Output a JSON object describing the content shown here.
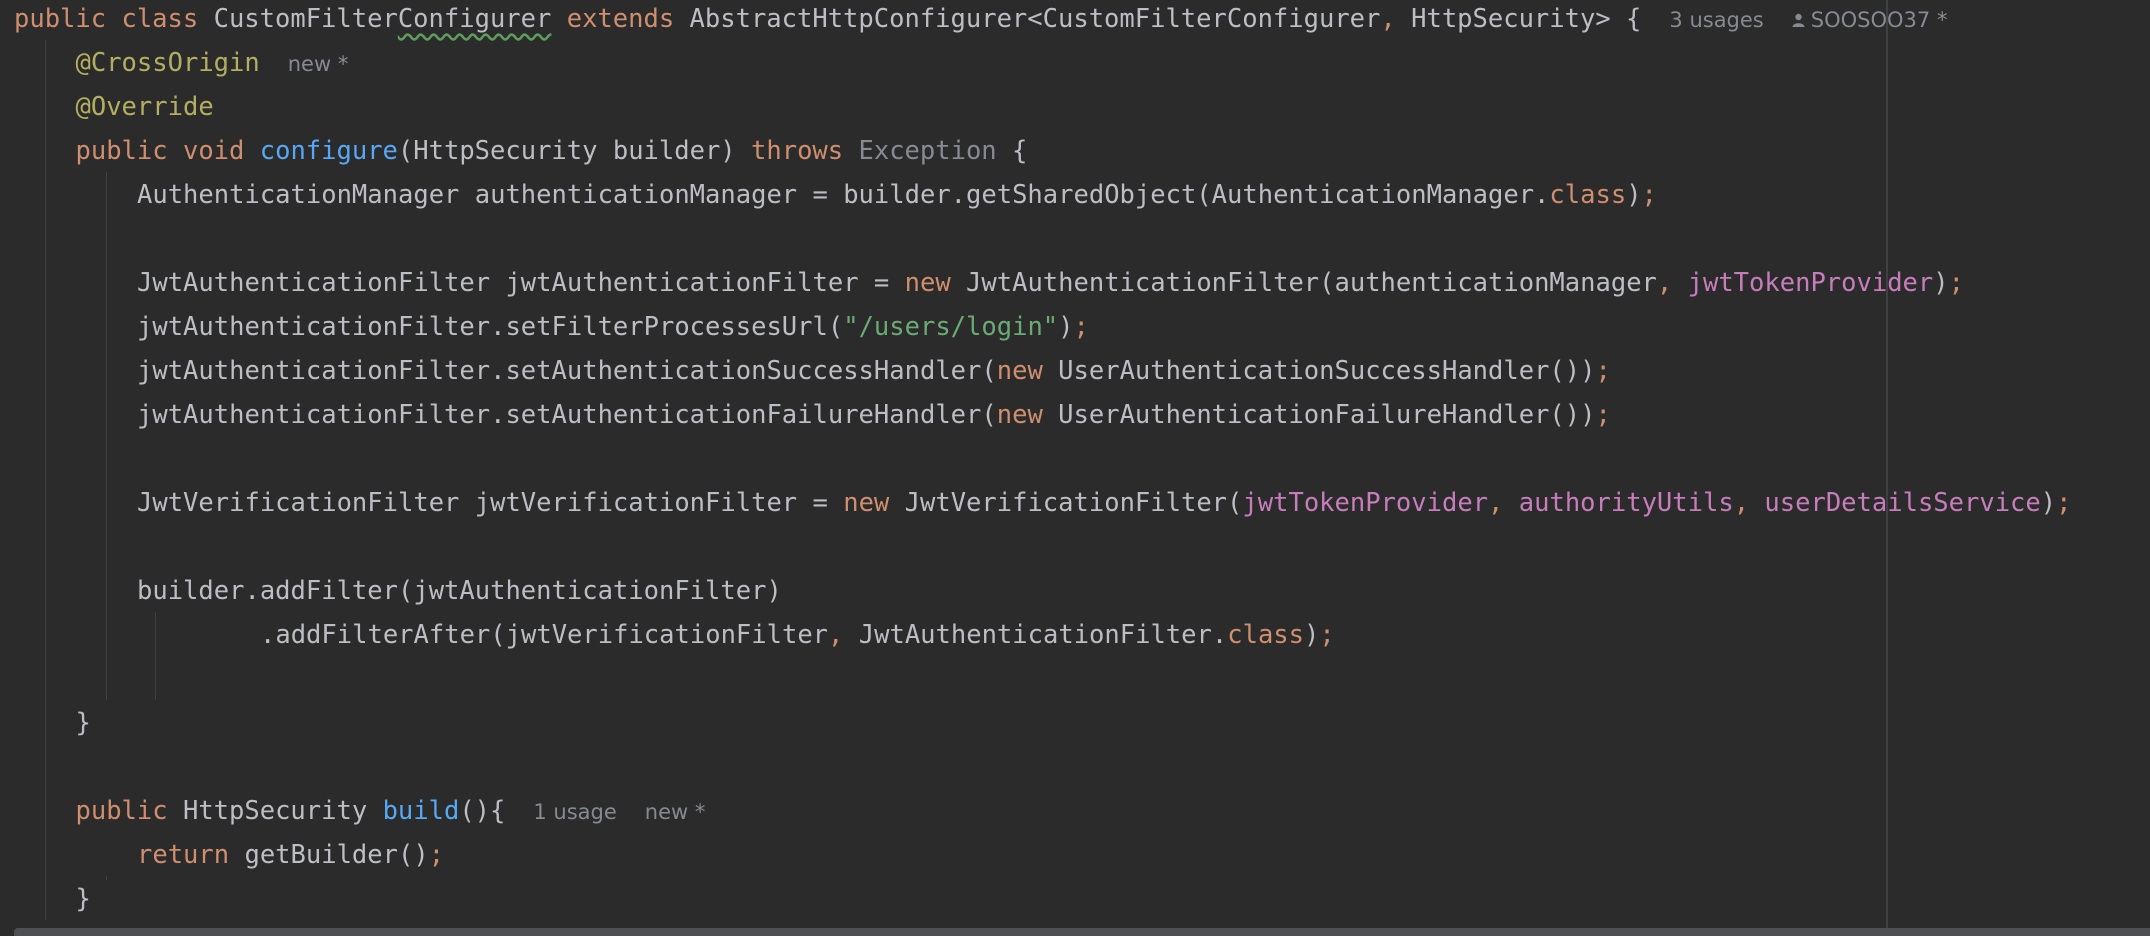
{
  "editor": {
    "lines": [
      {
        "indent": 0,
        "tokens": [
          [
            "kw",
            "public class "
          ],
          [
            "plain",
            "CustomFilter"
          ],
          [
            "plain squiggle",
            "Configurer"
          ],
          [
            "kw",
            " extends "
          ],
          [
            "plain",
            "AbstractHttpConfigurer<CustomFilterConfigurer"
          ],
          [
            "kw",
            ", "
          ],
          [
            "plain",
            "HttpSecurity> {"
          ]
        ],
        "hints": [
          "3 usages",
          "SOOSOO37 *"
        ]
      },
      {
        "indent": 1,
        "tokens": [
          [
            "ann",
            "@CrossOrigin"
          ]
        ],
        "hints": [
          "new *"
        ]
      },
      {
        "indent": 1,
        "tokens": [
          [
            "ann",
            "@Override"
          ]
        ],
        "hints": []
      },
      {
        "indent": 1,
        "tokens": [
          [
            "kw",
            "public void "
          ],
          [
            "fn",
            "configure"
          ],
          [
            "plain",
            "(HttpSecurity builder) "
          ],
          [
            "kw",
            "throws "
          ],
          [
            "gray",
            "Exception"
          ],
          [
            "plain",
            " {"
          ]
        ],
        "hints": []
      },
      {
        "indent": 2,
        "tokens": [
          [
            "plain",
            "AuthenticationManager authenticationManager = builder.getSharedObject(AuthenticationManager."
          ],
          [
            "kw",
            "class"
          ],
          [
            "plain",
            ")"
          ],
          [
            "kw",
            ";"
          ]
        ],
        "hints": []
      },
      {
        "indent": 0,
        "tokens": [],
        "hints": []
      },
      {
        "indent": 2,
        "tokens": [
          [
            "plain",
            "JwtAuthenticationFilter jwtAuthenticationFilter = "
          ],
          [
            "kw",
            "new "
          ],
          [
            "plain",
            "JwtAuthenticationFilter(authenticationManager"
          ],
          [
            "kw",
            ", "
          ],
          [
            "field",
            "jwtTokenProvider"
          ],
          [
            "plain",
            ")"
          ],
          [
            "kw",
            ";"
          ]
        ],
        "hints": []
      },
      {
        "indent": 2,
        "tokens": [
          [
            "plain",
            "jwtAuthenticationFilter.setFilterProcessesUrl("
          ],
          [
            "str",
            "\"/users/login\""
          ],
          [
            "plain",
            ")"
          ],
          [
            "kw",
            ";"
          ]
        ],
        "hints": []
      },
      {
        "indent": 2,
        "tokens": [
          [
            "plain",
            "jwtAuthenticationFilter.setAuthenticationSuccessHandler("
          ],
          [
            "kw",
            "new "
          ],
          [
            "plain",
            "UserAuthenticationSuccessHandler())"
          ],
          [
            "kw",
            ";"
          ]
        ],
        "hints": []
      },
      {
        "indent": 2,
        "tokens": [
          [
            "plain",
            "jwtAuthenticationFilter.setAuthenticationFailureHandler("
          ],
          [
            "kw",
            "new "
          ],
          [
            "plain",
            "UserAuthenticationFailureHandler())"
          ],
          [
            "kw",
            ";"
          ]
        ],
        "hints": []
      },
      {
        "indent": 0,
        "tokens": [],
        "hints": []
      },
      {
        "indent": 2,
        "tokens": [
          [
            "plain",
            "JwtVerificationFilter jwtVerificationFilter = "
          ],
          [
            "kw",
            "new "
          ],
          [
            "plain",
            "JwtVerificationFilter("
          ],
          [
            "field",
            "jwtTokenProvider"
          ],
          [
            "kw",
            ", "
          ],
          [
            "field",
            "authorityUtils"
          ],
          [
            "kw",
            ", "
          ],
          [
            "field",
            "userDetailsService"
          ],
          [
            "plain",
            ")"
          ],
          [
            "kw",
            ";"
          ]
        ],
        "hints": []
      },
      {
        "indent": 0,
        "tokens": [],
        "hints": []
      },
      {
        "indent": 2,
        "tokens": [
          [
            "plain",
            "builder.addFilter(jwtAuthenticationFilter)"
          ]
        ],
        "hints": []
      },
      {
        "indent": 4,
        "tokens": [
          [
            "plain",
            ".addFilterAfter(jwtVerificationFilter"
          ],
          [
            "kw",
            ", "
          ],
          [
            "plain",
            "JwtAuthenticationFilter."
          ],
          [
            "kw",
            "class"
          ],
          [
            "plain",
            ")"
          ],
          [
            "kw",
            ";"
          ]
        ],
        "hints": []
      },
      {
        "indent": 0,
        "tokens": [],
        "hints": []
      },
      {
        "indent": 1,
        "tokens": [
          [
            "plain",
            "}"
          ]
        ],
        "hints": []
      },
      {
        "indent": 0,
        "tokens": [],
        "hints": []
      },
      {
        "indent": 1,
        "tokens": [
          [
            "kw",
            "public "
          ],
          [
            "plain",
            "HttpSecurity "
          ],
          [
            "fn",
            "build"
          ],
          [
            "plain",
            "(){"
          ]
        ],
        "hints": [
          "1 usage",
          "new *"
        ]
      },
      {
        "indent": 2,
        "tokens": [
          [
            "kw",
            "return "
          ],
          [
            "plain",
            "getBuilder()"
          ],
          [
            "kw",
            ";"
          ]
        ],
        "hints": []
      },
      {
        "indent": 1,
        "tokens": [
          [
            "plain",
            "}"
          ]
        ],
        "hints": []
      }
    ]
  },
  "colors": {
    "background": "#2b2b2c",
    "keyword": "#cf8e6d",
    "method": "#56a8f5",
    "annotation": "#b3ae60",
    "string": "#6aab73",
    "field": "#c77dbb",
    "text": "#bcbec4",
    "hint": "#868a91"
  },
  "icons": {
    "author": "person-icon"
  }
}
